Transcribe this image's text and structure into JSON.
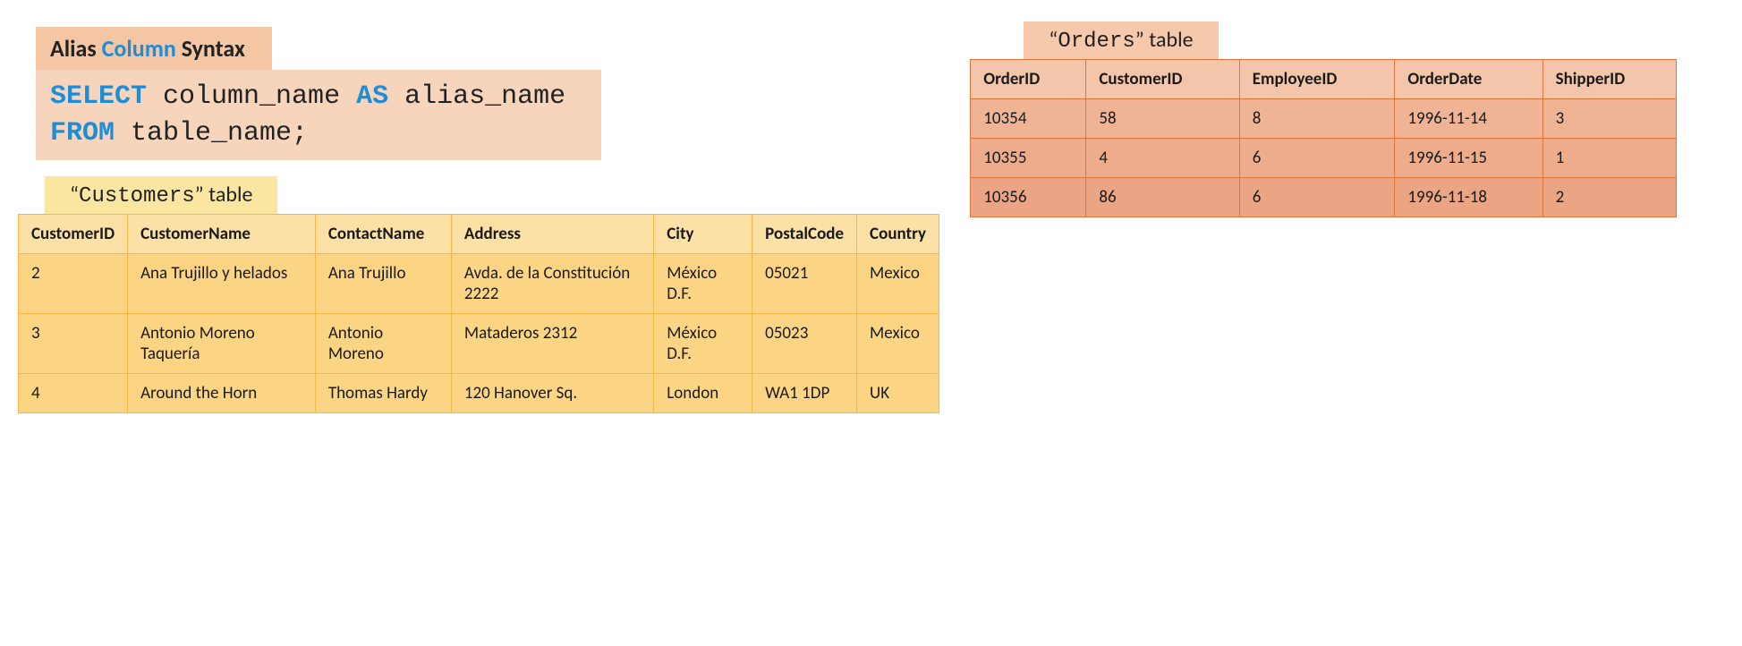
{
  "heading": {
    "pre": "Alias ",
    "highlight": "Column",
    "post": " Syntax"
  },
  "syntax": {
    "select": "SELECT",
    "col": " column_name ",
    "as": "AS",
    "alias": " alias_name",
    "from": "FROM",
    "table": " table_name;"
  },
  "customers": {
    "tab_pre": "“",
    "tab_name": "Customers",
    "tab_post": "” table",
    "headers": [
      "CustomerID",
      "CustomerName",
      "ContactName",
      "Address",
      "City",
      "PostalCode",
      "Country"
    ],
    "rows": [
      [
        "2",
        "Ana Trujillo y helados",
        "Ana Trujillo",
        "Avda. de la Constitución 2222",
        "México D.F.",
        "05021",
        "Mexico"
      ],
      [
        "3",
        "Antonio Moreno Taquería",
        "Antonio Moreno",
        "Mataderos 2312",
        "México D.F.",
        "05023",
        "Mexico"
      ],
      [
        "4",
        "Around the Horn",
        "Thomas Hardy",
        "120 Hanover Sq.",
        "London",
        "WA1 1DP",
        "UK"
      ]
    ]
  },
  "orders": {
    "tab_pre": "“",
    "tab_name": "Orders",
    "tab_post": "” table",
    "headers": [
      "OrderID",
      "CustomerID",
      "EmployeeID",
      "OrderDate",
      "ShipperID"
    ],
    "rows": [
      [
        "10354",
        "58",
        "8",
        "1996-11-14",
        "3"
      ],
      [
        "10355",
        "4",
        "6",
        "1996-11-15",
        "1"
      ],
      [
        "10356",
        "86",
        "6",
        "1996-11-18",
        "2"
      ]
    ]
  }
}
